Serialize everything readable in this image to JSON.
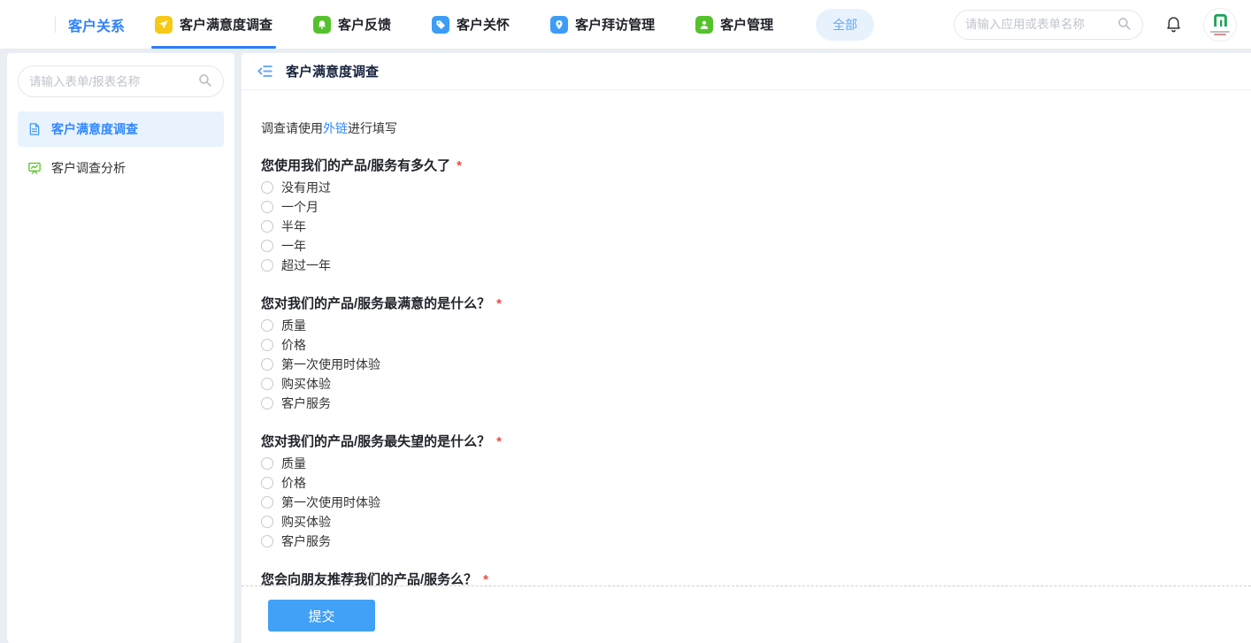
{
  "topbar": {
    "brand": "客户关系",
    "tabs": [
      {
        "label": "客户满意度调查",
        "icon": "paper-plane-icon",
        "icon_bg": "#f5c915",
        "active": true
      },
      {
        "label": "客户反馈",
        "icon": "bell-icon",
        "icon_bg": "#55c22d",
        "active": false
      },
      {
        "label": "客户关怀",
        "icon": "tag-icon",
        "icon_bg": "#3d9df6",
        "active": false
      },
      {
        "label": "客户拜访管理",
        "icon": "location-pin-icon",
        "icon_bg": "#3d9df6",
        "active": false
      },
      {
        "label": "客户管理",
        "icon": "person-icon",
        "icon_bg": "#55c22d",
        "active": false
      }
    ],
    "all_badge": "全部",
    "search_placeholder": "请输入应用或表单名称"
  },
  "sidebar": {
    "search_placeholder": "请输入表单/报表名称",
    "items": [
      {
        "label": "客户满意度调查",
        "icon": "document-icon",
        "active": true
      },
      {
        "label": "客户调查分析",
        "icon": "chart-board-icon",
        "active": false
      }
    ]
  },
  "main": {
    "title": "客户满意度调查",
    "intro": {
      "prefix": "调查请使用",
      "link": "外链",
      "suffix": "进行填写"
    },
    "questions": [
      {
        "label": "您使用我们的产品/服务有多久了",
        "required": "*",
        "options": [
          "没有用过",
          "一个月",
          "半年",
          "一年",
          "超过一年"
        ]
      },
      {
        "label": "您对我们的产品/服务最满意的是什么？",
        "required": "*",
        "options": [
          "质量",
          "价格",
          "第一次使用时体验",
          "购买体验",
          "客户服务"
        ]
      },
      {
        "label": "您对我们的产品/服务最失望的是什么？",
        "required": "*",
        "options": [
          "质量",
          "价格",
          "第一次使用时体验",
          "购买体验",
          "客户服务"
        ]
      },
      {
        "label": "您会向朋友推荐我们的产品/服务么？",
        "required": "*",
        "options": []
      }
    ],
    "submit_label": "提交"
  },
  "colors": {
    "accent_blue": "#2f82ff",
    "tab_underline": "#2b7cff",
    "link_blue": "#3388ff",
    "sidebar_active_bg": "#e9f3fe",
    "all_pill_bg": "#e8f2fd",
    "submit_blue": "#41a1f6",
    "required_red": "#f0483e",
    "page_bg": "#e9eef5"
  }
}
